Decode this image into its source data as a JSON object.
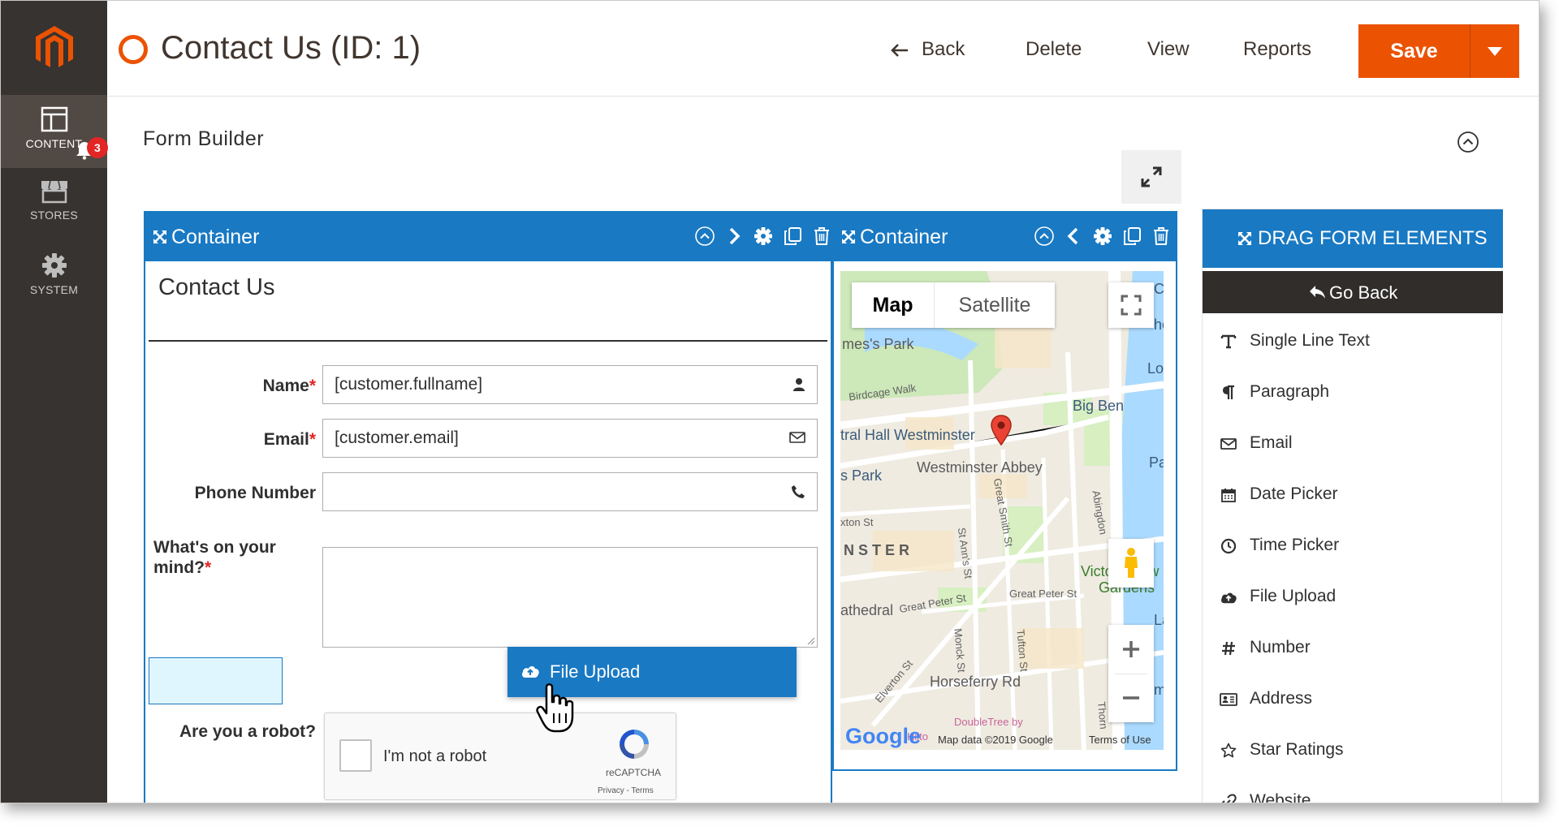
{
  "sidebar": {
    "items": [
      {
        "label": "CONTENT",
        "badge": "3",
        "icon": "content-layout-icon"
      },
      {
        "label": "STORES",
        "icon": "store-icon"
      },
      {
        "label": "SYSTEM",
        "icon": "gear-icon"
      }
    ]
  },
  "header": {
    "title": "Contact Us (ID: 1)",
    "back_label": "Back",
    "delete_label": "Delete",
    "view_label": "View",
    "reports_label": "Reports",
    "save_label": "Save"
  },
  "main": {
    "section_title": "Form Builder"
  },
  "containers": [
    {
      "label": "Container"
    },
    {
      "label": "Container"
    }
  ],
  "form": {
    "title": "Contact Us",
    "fields": [
      {
        "label": "Name",
        "required": "*",
        "value": "[customer.fullname]",
        "icon": "user-icon"
      },
      {
        "label": "Email",
        "required": "*",
        "value": "[customer.email]",
        "icon": "envelope-icon"
      },
      {
        "label": "Phone Number",
        "required": "",
        "value": "",
        "icon": "phone-icon"
      },
      {
        "label": "What's on your mind?",
        "required": "*",
        "value": ""
      }
    ],
    "robot_label": "Are you a robot?",
    "recaptcha": {
      "text": "I'm not a robot",
      "brand": "reCAPTCHA",
      "terms": "Privacy - Terms"
    },
    "dragging": {
      "label": "File Upload"
    }
  },
  "map": {
    "map_type_selected": "Map",
    "map_type_other": "Satellite",
    "labels": [
      "mes's Park",
      "Birdcage Walk",
      "tral Hall Westminster",
      "Westminster Abbey",
      "Big Ben",
      "s Park",
      "NSTER",
      "Victoria Tow",
      "Gardens",
      "athedral",
      "Horseferry Rd",
      "Lo",
      "Pa",
      "C",
      "he",
      "La",
      "mb"
    ],
    "streets": [
      "Great Peter St",
      "Great Peter St",
      "Great Smith St",
      "St Ann's St",
      "Abingdon",
      "Monck St",
      "Tufton St",
      "Elverton St",
      "xton St",
      "Thorn",
      "DoubleTree by",
      "Hilto"
    ],
    "brand": "Google",
    "attribution": "Map data ©2019 Google",
    "terms": "Terms of Use"
  },
  "panel": {
    "title": "DRAG FORM ELEMENTS",
    "go_back": "Go Back",
    "items": [
      {
        "label": "Single Line Text",
        "icon": "text-icon"
      },
      {
        "label": "Paragraph",
        "icon": "paragraph-icon"
      },
      {
        "label": "Email",
        "icon": "envelope-icon"
      },
      {
        "label": "Date Picker",
        "icon": "calendar-icon"
      },
      {
        "label": "Time Picker",
        "icon": "clock-icon"
      },
      {
        "label": "File Upload",
        "icon": "cloud-upload-icon"
      },
      {
        "label": "Number",
        "icon": "hash-icon"
      },
      {
        "label": "Address",
        "icon": "address-card-icon"
      },
      {
        "label": "Star Ratings",
        "icon": "star-icon"
      },
      {
        "label": "Website",
        "icon": "link-icon"
      }
    ]
  },
  "colors": {
    "accent": "#eb5202",
    "primary": "#1979c3",
    "sidebar": "#373330",
    "required": "#e22626"
  }
}
